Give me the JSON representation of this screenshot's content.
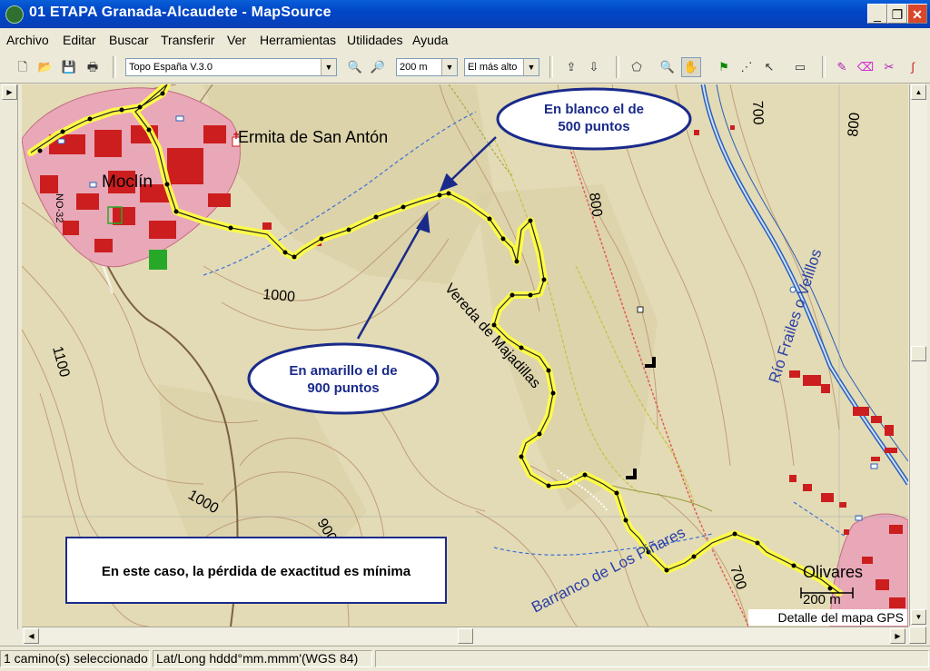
{
  "window": {
    "title": "01 ETAPA Granada-Alcaudete - MapSource"
  },
  "menu": [
    "Archivo",
    "Editar",
    "Buscar",
    "Transferir",
    "Ver",
    "Herramientas",
    "Utilidades",
    "Ayuda"
  ],
  "toolbar": {
    "map_product": "Topo España V.3.0",
    "zoom_scale": "200 m",
    "detail_level": "El más alto"
  },
  "map": {
    "labels": {
      "town_main": "Moclín",
      "chapel": "Ermita de San Antón",
      "town_2": "Olivares",
      "path": "Vereda de Majadillas",
      "stream": "Barranco de Los Piñares",
      "river": "Río Frailes o Velillos",
      "road": "NO-32"
    },
    "contours": [
      "1000",
      "1100",
      "1000",
      "900",
      "800",
      "800",
      "700",
      "700",
      "900"
    ],
    "callouts": {
      "white_track": "En blanco el de 500 puntos",
      "white_track_line1": "En blanco el de",
      "white_track_line2": "500 puntos",
      "yellow_track": "En amarillo el de 900 puntos",
      "yellow_track_line1": "En amarillo el de",
      "yellow_track_line2": "900 puntos"
    },
    "note": "En este caso, la pérdida de exactitud es mínima",
    "scale": "200 m",
    "detail_caption": "Detalle del mapa GPS"
  },
  "status": {
    "selection": "1 camino(s) seleccionado",
    "coords": "Lat/Long hddd°mm.mmm'(WGS 84)"
  },
  "colors": {
    "track_yellow": "#ffff40",
    "terrain": "#e3dbb5",
    "urban": "#e8a8b8",
    "callout_border": "#1a2a8a",
    "water": "#2a5fb8"
  }
}
